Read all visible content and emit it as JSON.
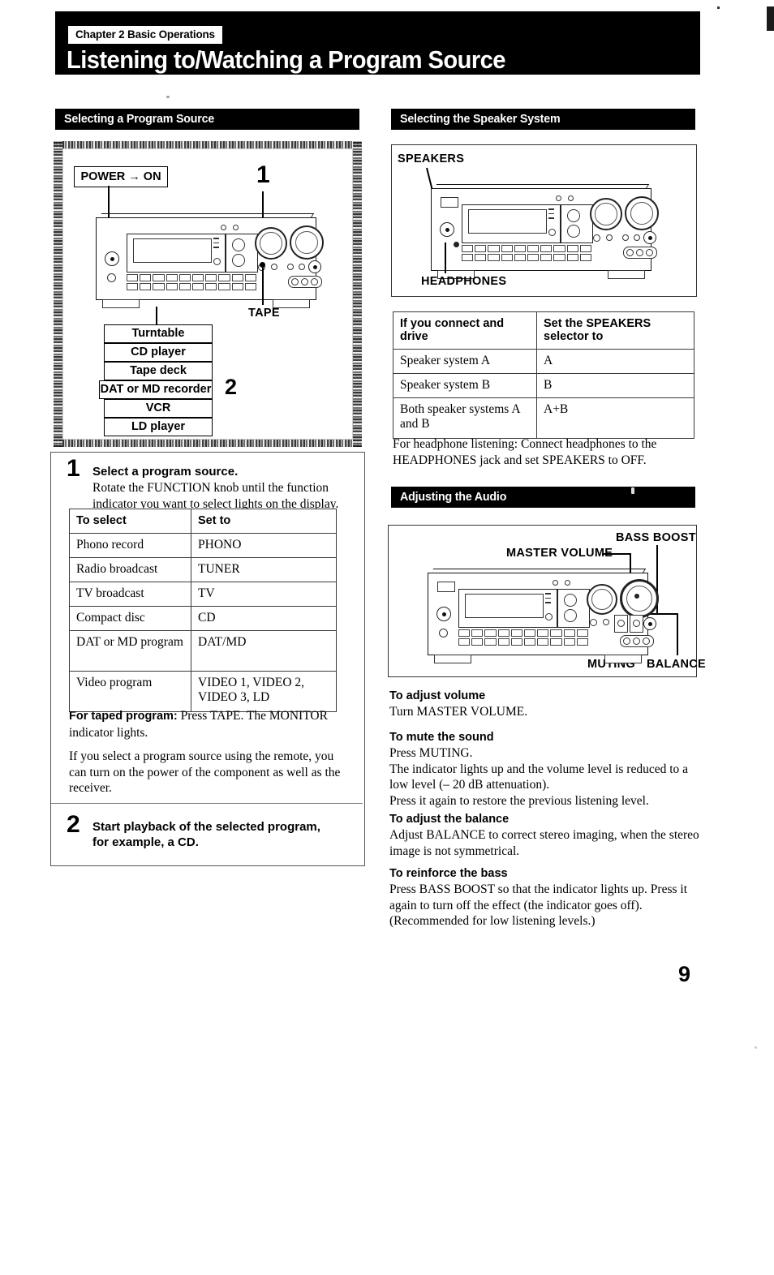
{
  "header": {
    "chapter": "Chapter 2 Basic Operations",
    "title": "Listening to/Watching a Program Source"
  },
  "sections": {
    "program_source": {
      "bar_label": "Selecting a Program Source",
      "figure": {
        "power_label": "POWER → ON",
        "callout_1": "1",
        "callout_2": "2",
        "tape_label": "TAPE",
        "source_boxes": [
          "Turntable",
          "CD player",
          "Tape deck",
          "DAT or MD recorder",
          "VCR",
          "LD player"
        ]
      },
      "step1": {
        "number": "1",
        "title": "Select a program source.",
        "body": "Rotate the FUNCTION knob until the function indicator you want to select lights on the display."
      },
      "table": {
        "headers": [
          "To select",
          "Set to"
        ],
        "rows": [
          [
            "Phono record",
            "PHONO"
          ],
          [
            "Radio broadcast",
            "TUNER"
          ],
          [
            "TV broadcast",
            "TV"
          ],
          [
            "Compact disc",
            "CD"
          ],
          [
            "DAT or MD program",
            "DAT/MD"
          ],
          [
            "Video program",
            "VIDEO 1, VIDEO 2, VIDEO 3, LD"
          ]
        ]
      },
      "note_taped_lead": "For taped program:",
      "note_taped_rest": " Press TAPE.  The MONITOR indicator lights.",
      "note_remote": "If you select a program source using the remote, you can turn on the power of the component as well as the receiver.",
      "step2": {
        "number": "2",
        "title": "Start playback of the selected program, for example, a CD."
      }
    },
    "speaker_system": {
      "bar_label": "Selecting the Speaker System",
      "figure": {
        "speakers_label": "SPEAKERS",
        "headphones_label": "HEADPHONES"
      },
      "table": {
        "headers": [
          "If you connect and drive",
          "Set the SPEAKERS selector to"
        ],
        "rows": [
          [
            "Speaker system A",
            "A"
          ],
          [
            "Speaker system B",
            "B"
          ],
          [
            "Both speaker systems A and B",
            "A+B"
          ]
        ]
      },
      "note": "For headphone listening: Connect headphones to the HEADPHONES jack and set SPEAKERS to OFF."
    },
    "adjusting_audio": {
      "bar_label": "Adjusting the Audio",
      "figure": {
        "master_volume_label": "MASTER VOLUME",
        "bass_boost_label": "BASS BOOST",
        "muting_label": "MUTING",
        "balance_label": "BALANCE"
      },
      "topics": [
        {
          "heading": "To adjust volume",
          "body": "Turn MASTER VOLUME."
        },
        {
          "heading": "To mute the sound",
          "body": "Press MUTING.\nThe indicator lights up and the volume level is reduced to a low level (– 20 dB attenuation).\nPress it again to restore the previous listening level."
        },
        {
          "heading": "To adjust the balance",
          "body": "Adjust BALANCE to correct stereo imaging, when the stereo image is not symmetrical."
        },
        {
          "heading": "To reinforce the bass",
          "body": "Press BASS BOOST so that the indicator lights up.  Press it again to turn off the effect (the indicator goes off).\n(Recommended for low listening levels.)"
        }
      ]
    }
  },
  "footer": {
    "page_number": "9"
  }
}
